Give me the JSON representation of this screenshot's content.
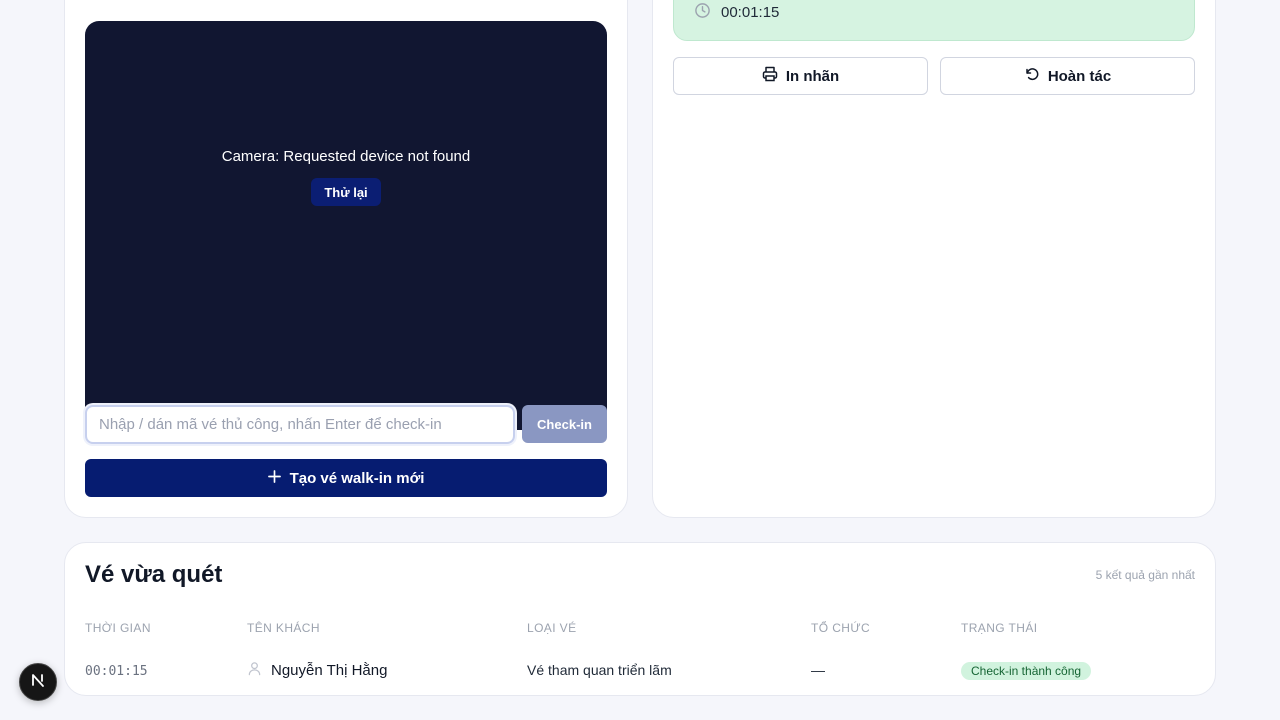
{
  "scanner": {
    "camera_error": "Camera: Requested device not found",
    "retry_label": "Thử lại",
    "manual_placeholder": "Nhập / dán mã vé thủ công, nhấn Enter để check-in",
    "checkin_label": "Check-in",
    "walkin_label": "Tạo vé walk-in mới"
  },
  "result": {
    "time": "00:01:15",
    "print_label": "In nhãn",
    "undo_label": "Hoàn tác"
  },
  "recent": {
    "title": "Vé vừa quét",
    "subtitle": "5 kết quả gần nhất",
    "columns": [
      "THỜI GIAN",
      "TÊN KHÁCH",
      "LOẠI VÉ",
      "TỔ CHỨC",
      "TRẠNG THÁI"
    ],
    "rows": [
      {
        "time": "00:01:15",
        "name": "Nguyễn Thị Hằng",
        "ticket_type": "Vé tham quan triển lãm",
        "organization": "—",
        "status": "Check-in thành công"
      }
    ]
  },
  "fab": {
    "letter": "N"
  },
  "colors": {
    "primary": "#061c71",
    "camera_bg": "#111631",
    "success_bg": "#d6f3e1",
    "badge_bg": "#d1f3de",
    "badge_text": "#166534"
  },
  "icons": [
    "clock-icon",
    "printer-icon",
    "undo-icon",
    "plus-icon",
    "user-icon",
    "next-logo-icon"
  ]
}
